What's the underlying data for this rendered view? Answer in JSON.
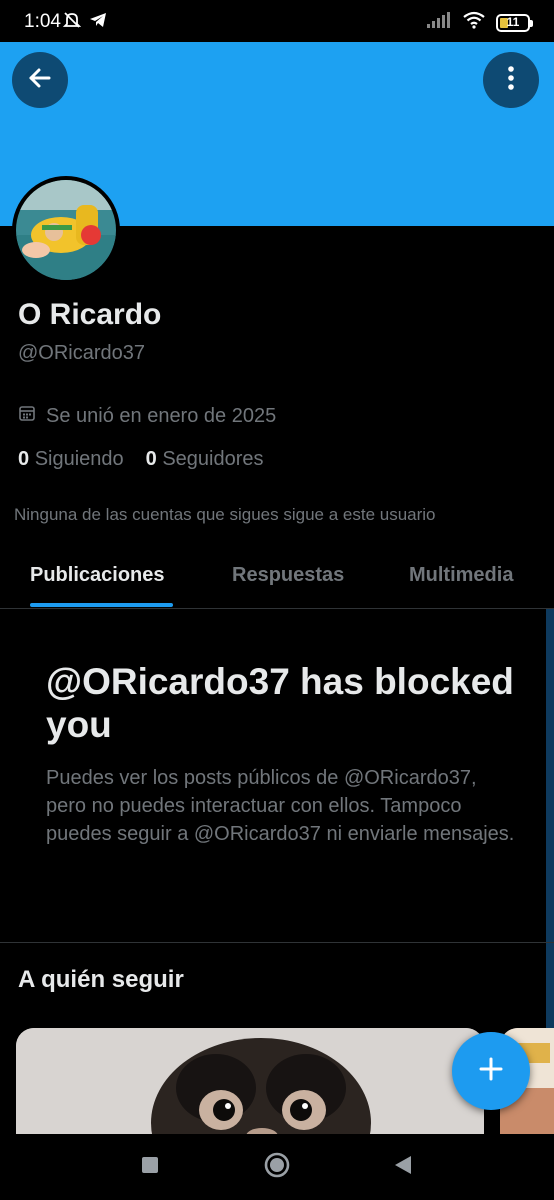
{
  "status_bar": {
    "time": "1:04",
    "battery": "11",
    "icons": [
      "mute-icon",
      "telegram-icon",
      "signal-icon",
      "wifi-icon",
      "battery-icon"
    ]
  },
  "header": {
    "banner_color": "#1da1f2",
    "back_icon": "arrow-left-icon",
    "more_icon": "more-vertical-icon"
  },
  "profile": {
    "name": "O Ricardo",
    "handle": "@ORicardo37",
    "joined": "Se unió en enero de 2025",
    "following_count": "0",
    "following_label": "Siguiendo",
    "followers_count": "0",
    "followers_label": "Seguidores",
    "mutuals_notice": "Ninguna de las cuentas que sigues sigue a este usuario"
  },
  "tabs": [
    {
      "label": "Publicaciones",
      "active": true
    },
    {
      "label": "Respuestas",
      "active": false
    },
    {
      "label": "Multimedia",
      "active": false
    }
  ],
  "blocked": {
    "title": "@ORicardo37 has blocked you",
    "message": "Puedes ver los posts públicos de @ORicardo37, pero no puedes interactuar con ellos. Tampoco puedes seguir a @ORicardo37 ni enviarle mensajes."
  },
  "who_to_follow": {
    "title": "A quién seguir"
  },
  "fab": {
    "icon": "plus-icon"
  },
  "nav_bar": {
    "icons": [
      "recents-square-icon",
      "home-circle-icon",
      "back-triangle-icon"
    ]
  },
  "colors": {
    "accent": "#1d9bf0",
    "muted_text": "#71767b",
    "primary_text": "#e7e9ea",
    "background": "#000000"
  }
}
